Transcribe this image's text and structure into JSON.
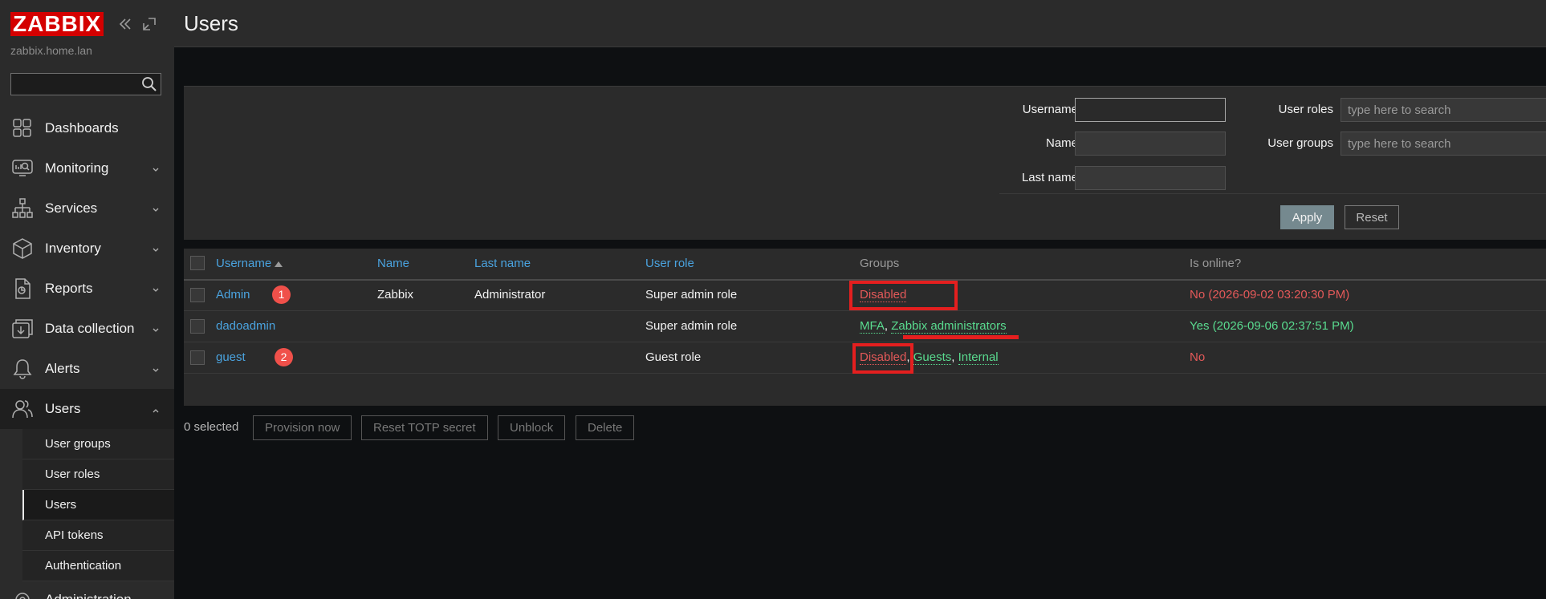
{
  "sidebar": {
    "logo": "ZABBIX",
    "server_name": "zabbix.home.lan",
    "search_value": "",
    "nav": [
      {
        "label": "Dashboards",
        "icon": "dashboards-icon"
      },
      {
        "label": "Monitoring",
        "icon": "monitoring-icon"
      },
      {
        "label": "Services",
        "icon": "services-icon"
      },
      {
        "label": "Inventory",
        "icon": "inventory-icon"
      },
      {
        "label": "Reports",
        "icon": "reports-icon"
      },
      {
        "label": "Data collection",
        "icon": "data-collection-icon"
      },
      {
        "label": "Alerts",
        "icon": "alerts-icon"
      },
      {
        "label": "Users",
        "icon": "users-icon"
      }
    ],
    "submenu": [
      {
        "label": "User groups"
      },
      {
        "label": "User roles"
      },
      {
        "label": "Users"
      },
      {
        "label": "API tokens"
      },
      {
        "label": "Authentication"
      }
    ],
    "last_item": "Administration"
  },
  "header": {
    "title": "Users"
  },
  "filter": {
    "username_label": "Username",
    "username_value": "",
    "name_label": "Name",
    "name_value": "",
    "lastname_label": "Last name",
    "lastname_value": "",
    "roles_label": "User roles",
    "roles_placeholder": "type here to search",
    "groups_label": "User groups",
    "groups_placeholder": "type here to search",
    "apply_label": "Apply",
    "reset_label": "Reset"
  },
  "table": {
    "headers": {
      "username": "Username",
      "name": "Name",
      "lastname": "Last name",
      "role": "User role",
      "groups": "Groups",
      "online": "Is online?"
    },
    "rows": [
      {
        "username": "Admin",
        "badge": "1",
        "name": "Zabbix",
        "lastname": "Administrator",
        "role": "Super admin role",
        "groups": [
          "Disabled"
        ],
        "online": "No (2026-09-02 03:20:30 PM)"
      },
      {
        "username": "dadoadmin",
        "name": "",
        "lastname": "",
        "role": "Super admin role",
        "groups": [
          "MFA",
          "Zabbix administrators"
        ],
        "online": "Yes (2026-09-06 02:37:51 PM)"
      },
      {
        "username": "guest",
        "badge": "2",
        "name": "",
        "lastname": "",
        "role": "Guest role",
        "groups": [
          "Disabled",
          "Guests",
          "Internal"
        ],
        "online": "No"
      }
    ]
  },
  "actions": {
    "selected": "0 selected",
    "provision": "Provision now",
    "reset_totp": "Reset TOTP secret",
    "unblock": "Unblock",
    "delete": "Delete"
  },
  "colors": {
    "brand": "#d40000",
    "link": "#4aa3df",
    "ok": "#59db8f",
    "problem": "#e45959",
    "highlight": "#e41f1f"
  }
}
